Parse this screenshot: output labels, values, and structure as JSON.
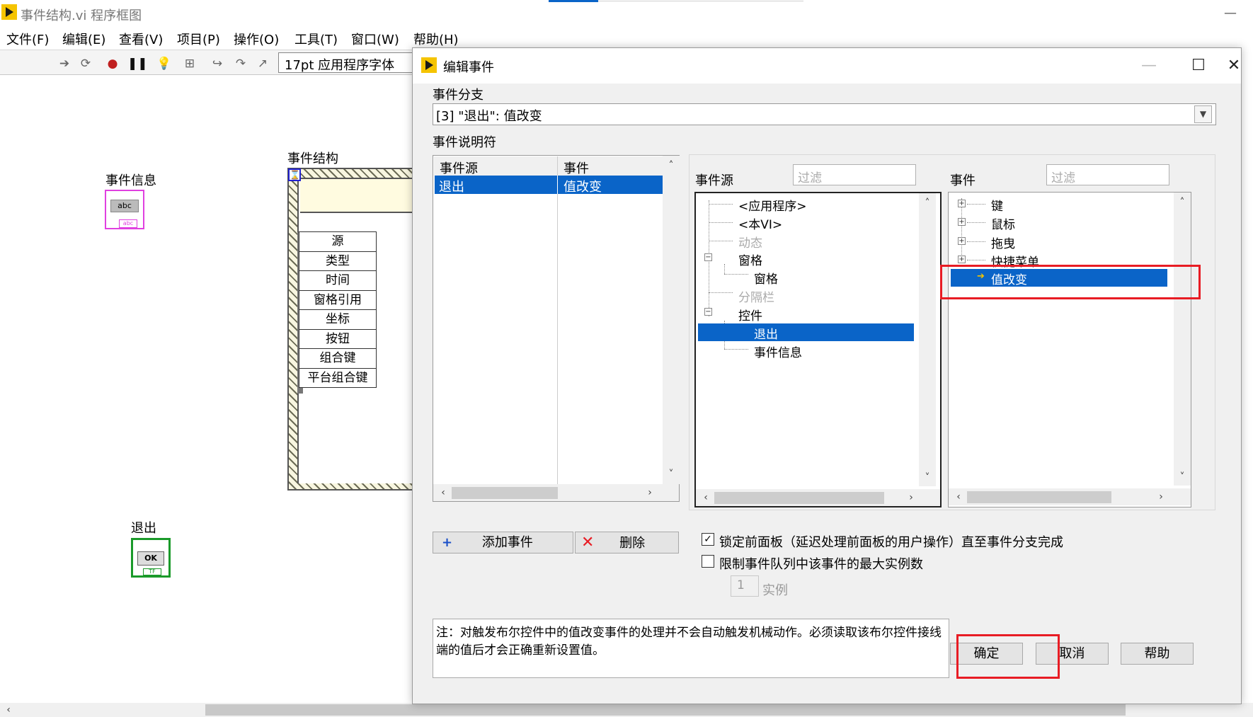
{
  "main_window": {
    "title": "事件结构.vi 程序框图",
    "minimize": "—"
  },
  "menubar": {
    "items": [
      "文件(F)",
      "编辑(E)",
      "查看(V)",
      "项目(P)",
      "操作(O)",
      "工具(T)",
      "窗口(W)",
      "帮助(H)"
    ]
  },
  "toolbar": {
    "font": "17pt 应用程序字体"
  },
  "block_diagram": {
    "event_info_label": "事件信息",
    "event_info_glyph": "abc",
    "event_info_foot": "abc",
    "exit_label": "退出",
    "exit_glyph": "OK",
    "exit_foot": "TF",
    "event_structure_label": "事件结构",
    "event_structure_icon": "⌛",
    "terminals": [
      "源",
      "类型",
      "时间",
      "窗格引用",
      "坐标",
      "按钮",
      "组合键",
      "平台组合键"
    ]
  },
  "dialog": {
    "title": "编辑事件",
    "controls": {
      "minimize": "—",
      "maximize": "☐",
      "close": "✕"
    },
    "branch_label": "事件分支",
    "branch_value": "[3] \"退出\": 值改变",
    "specifiers_label": "事件说明符",
    "table": {
      "headers": [
        "事件源",
        "事件"
      ],
      "rows": [
        [
          "退出",
          "值改变"
        ]
      ]
    },
    "source_label": "事件源",
    "event_label": "事件",
    "filter_placeholder": "过滤",
    "source_tree": [
      {
        "label": "<应用程序>",
        "dim": false
      },
      {
        "label": "<本VI>",
        "dim": false
      },
      {
        "label": "动态",
        "dim": true
      },
      {
        "label": "窗格",
        "dim": false
      },
      {
        "label": "窗格",
        "dim": false
      },
      {
        "label": "分隔栏",
        "dim": true
      },
      {
        "label": "控件",
        "dim": false
      },
      {
        "label": "退出",
        "dim": false,
        "selected": true
      },
      {
        "label": "事件信息",
        "dim": false
      }
    ],
    "event_tree": [
      {
        "label": "键"
      },
      {
        "label": "鼠标"
      },
      {
        "label": "拖曳"
      },
      {
        "label": "快捷菜单"
      },
      {
        "label": "值改变",
        "selected": true
      }
    ],
    "add_event_label": "添加事件",
    "delete_label": "删除",
    "lock_panel_label": "锁定前面板（延迟处理前面板的用户操作）直至事件分支完成",
    "lock_panel_checked": true,
    "limit_queue_label": "限制事件队列中该事件的最大实例数",
    "limit_queue_checked": false,
    "instances_value": "1",
    "instances_label": "实例",
    "note": "注：对触发布尔控件中的值改变事件的处理并不会自动触发机械动作。必须读取该布尔控件接线端的值后才会正确重新设置值。",
    "ok_label": "确定",
    "cancel_label": "取消",
    "help_label": "帮助"
  },
  "colors": {
    "selection": "#0a64c8",
    "highlight_box": "#e81c24",
    "labview_yellow": "#f5c400"
  }
}
